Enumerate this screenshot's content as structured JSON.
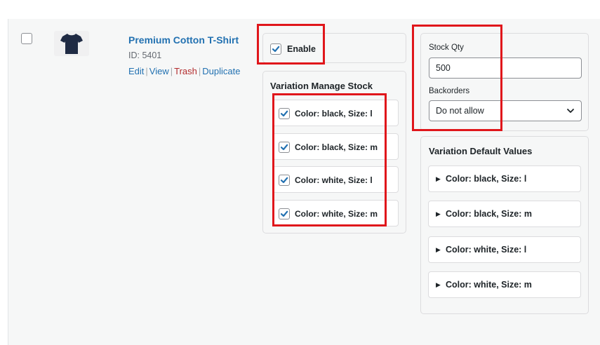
{
  "product": {
    "name": "Premium Cotton T-Shirt",
    "id_text": "ID: 5401",
    "actions": {
      "edit": "Edit",
      "view": "View",
      "trash": "Trash",
      "duplicate": "Duplicate"
    },
    "thumbnail_icon": "tshirt-icon"
  },
  "enable": {
    "label": "Enable",
    "checked": true
  },
  "variation_manage_stock": {
    "title": "Variation Manage Stock",
    "items": [
      {
        "label": "Color: black, Size: l",
        "checked": true
      },
      {
        "label": "Color: black, Size: m",
        "checked": true
      },
      {
        "label": "Color: white, Size: l",
        "checked": true
      },
      {
        "label": "Color: white, Size: m",
        "checked": true
      }
    ]
  },
  "stock": {
    "qty_label": "Stock Qty",
    "qty_value": "500",
    "backorders_label": "Backorders",
    "backorders_value": "Do not allow"
  },
  "variation_default_values": {
    "title": "Variation Default Values",
    "items": [
      {
        "label": "Color: black, Size: l"
      },
      {
        "label": "Color: black, Size: m"
      },
      {
        "label": "Color: white, Size: l"
      },
      {
        "label": "Color: white, Size: m"
      }
    ]
  },
  "colors": {
    "link": "#2271b1",
    "trash": "#b32d2e",
    "checkbox": "#2271b1",
    "highlight": "#e0161b"
  }
}
